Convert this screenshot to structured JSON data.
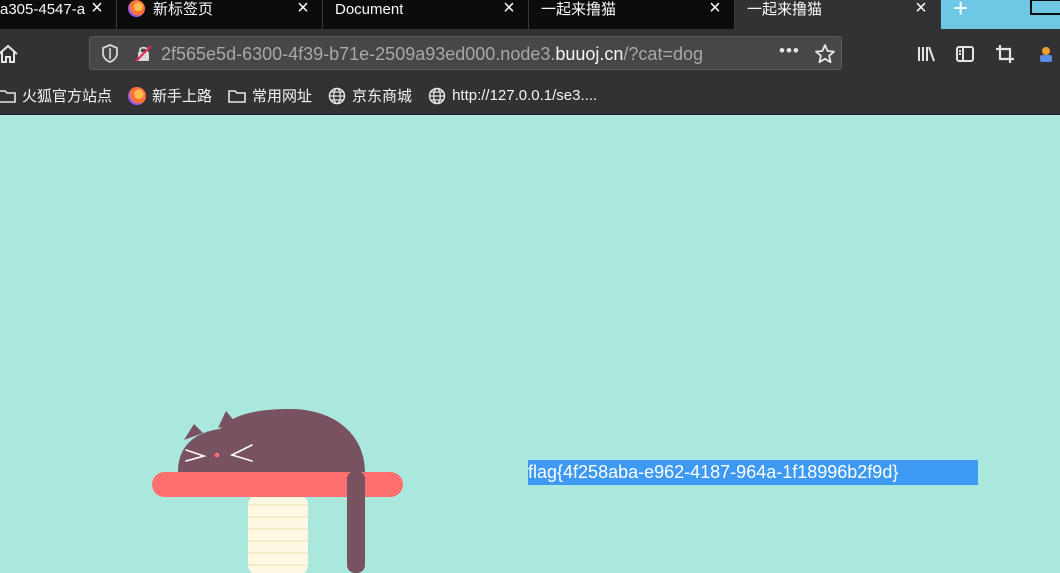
{
  "tabs": [
    {
      "title": "a305-4547-a",
      "close": "×",
      "active": false
    },
    {
      "title": "新标签页",
      "close": "×",
      "active": false
    },
    {
      "title": "Document",
      "close": "×",
      "active": false
    },
    {
      "title": "一起来撸猫",
      "close": "×",
      "active": false
    },
    {
      "title": "一起来撸猫",
      "close": "×",
      "active": true
    }
  ],
  "new_tab_label": "+",
  "url": {
    "prefix": "2f565e5d-6300-4f39-b71e-2509a93ed000.node3.",
    "host": "buuoj.cn",
    "suffix": "/?cat=dog"
  },
  "url_menu": "•••",
  "bookmarks": [
    {
      "label": "火狐官方站点",
      "icon": "folder-icon"
    },
    {
      "label": "新手上路",
      "icon": "firefox-icon"
    },
    {
      "label": "常用网址",
      "icon": "folder-icon"
    },
    {
      "label": "京东商城",
      "icon": "globe-icon"
    },
    {
      "label": "http://127.0.0.1/se3....",
      "icon": "globe-icon"
    }
  ],
  "page": {
    "flag_text": "flag{4f258aba-e962-4187-964a-1f18996b2f9d}"
  },
  "colors": {
    "page_background": "#aae7dd",
    "selection": "#3d99f2",
    "cat": "#785261",
    "perch": "#ff6f6f",
    "post": "#fff8e2",
    "new_tab": "#6fc7e6"
  }
}
